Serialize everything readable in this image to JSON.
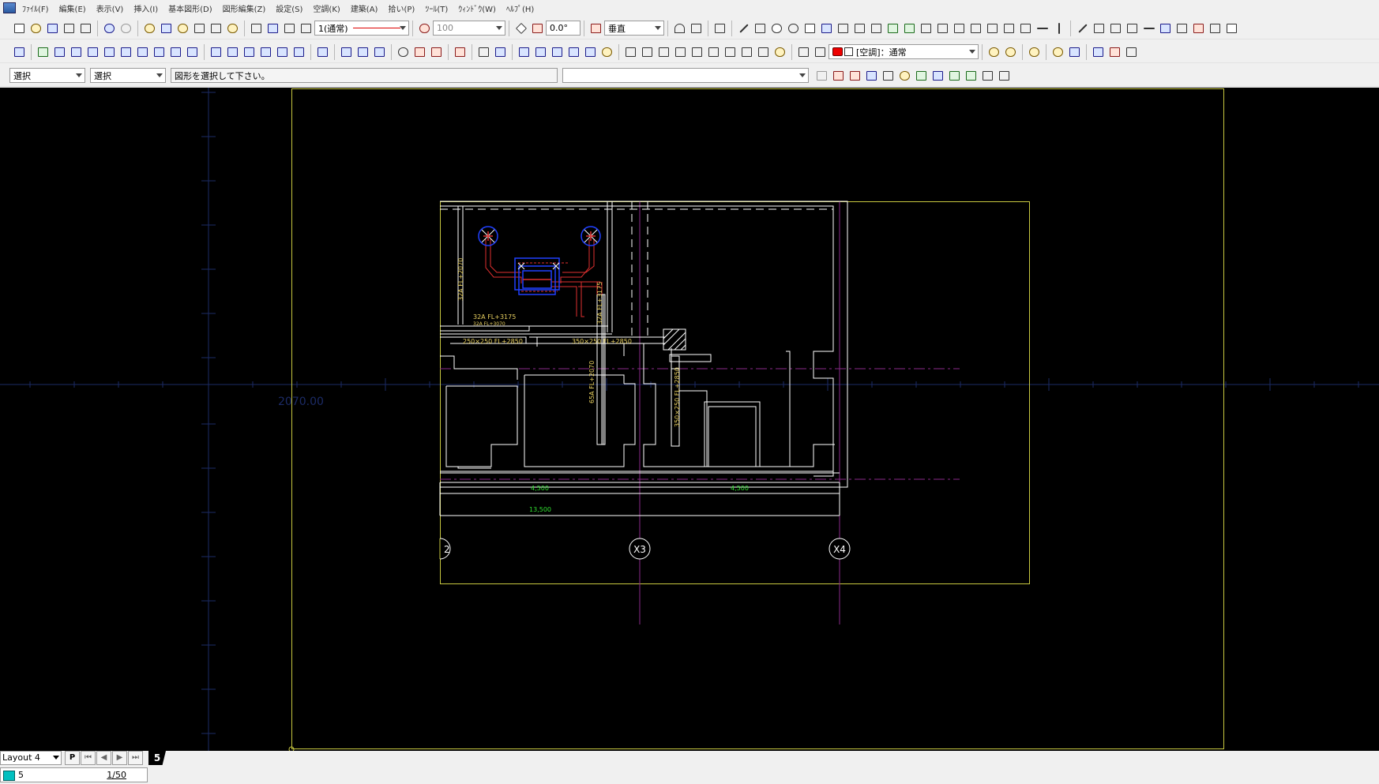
{
  "menu": [
    "ﾌｧｲﾙ(F)",
    "編集(E)",
    "表示(V)",
    "挿入(I)",
    "基本図形(D)",
    "図形編集(Z)",
    "設定(S)",
    "空調(K)",
    "建築(A)",
    "拾い(P)",
    "ﾂｰﾙ(T)",
    "ｳｨﾝﾄﾞｳ(W)",
    "ﾍﾙﾌﾟ(H)"
  ],
  "toolbar1": {
    "linetype": "1(通常)",
    "scale_value": "100",
    "angle_value": "0.0°",
    "direction": "垂直"
  },
  "toolbar2": {
    "layer_combo": "[空調]：通常"
  },
  "toolbar3": {
    "mode1": "選択",
    "mode2": "選択",
    "prompt": "図形を選択して下さい。",
    "command_input": ""
  },
  "drawing": {
    "coord_readout": "2070.00",
    "labels": {
      "duct1": "250×250 FL+2850",
      "duct2": "350×250 FL+2850",
      "duct3": "350×250 FL+2850",
      "pipe1": "32A FL+3175",
      "pipe2": "32A FL+3070",
      "pipe3": "32A FL+3175",
      "pipe4": "32A FL+2070",
      "pipe5": "65A FL+2070",
      "pipe6": "32A FL+2070"
    },
    "dimensions": {
      "dim1": "4,500",
      "dim2": "4,500",
      "total": "13,500"
    },
    "grid_labels": [
      "2",
      "X3",
      "X4"
    ]
  },
  "status": {
    "layout": "Layout 4",
    "p_button": "P",
    "tab_number": "5",
    "layer_number": "5",
    "scale": "1/50"
  }
}
